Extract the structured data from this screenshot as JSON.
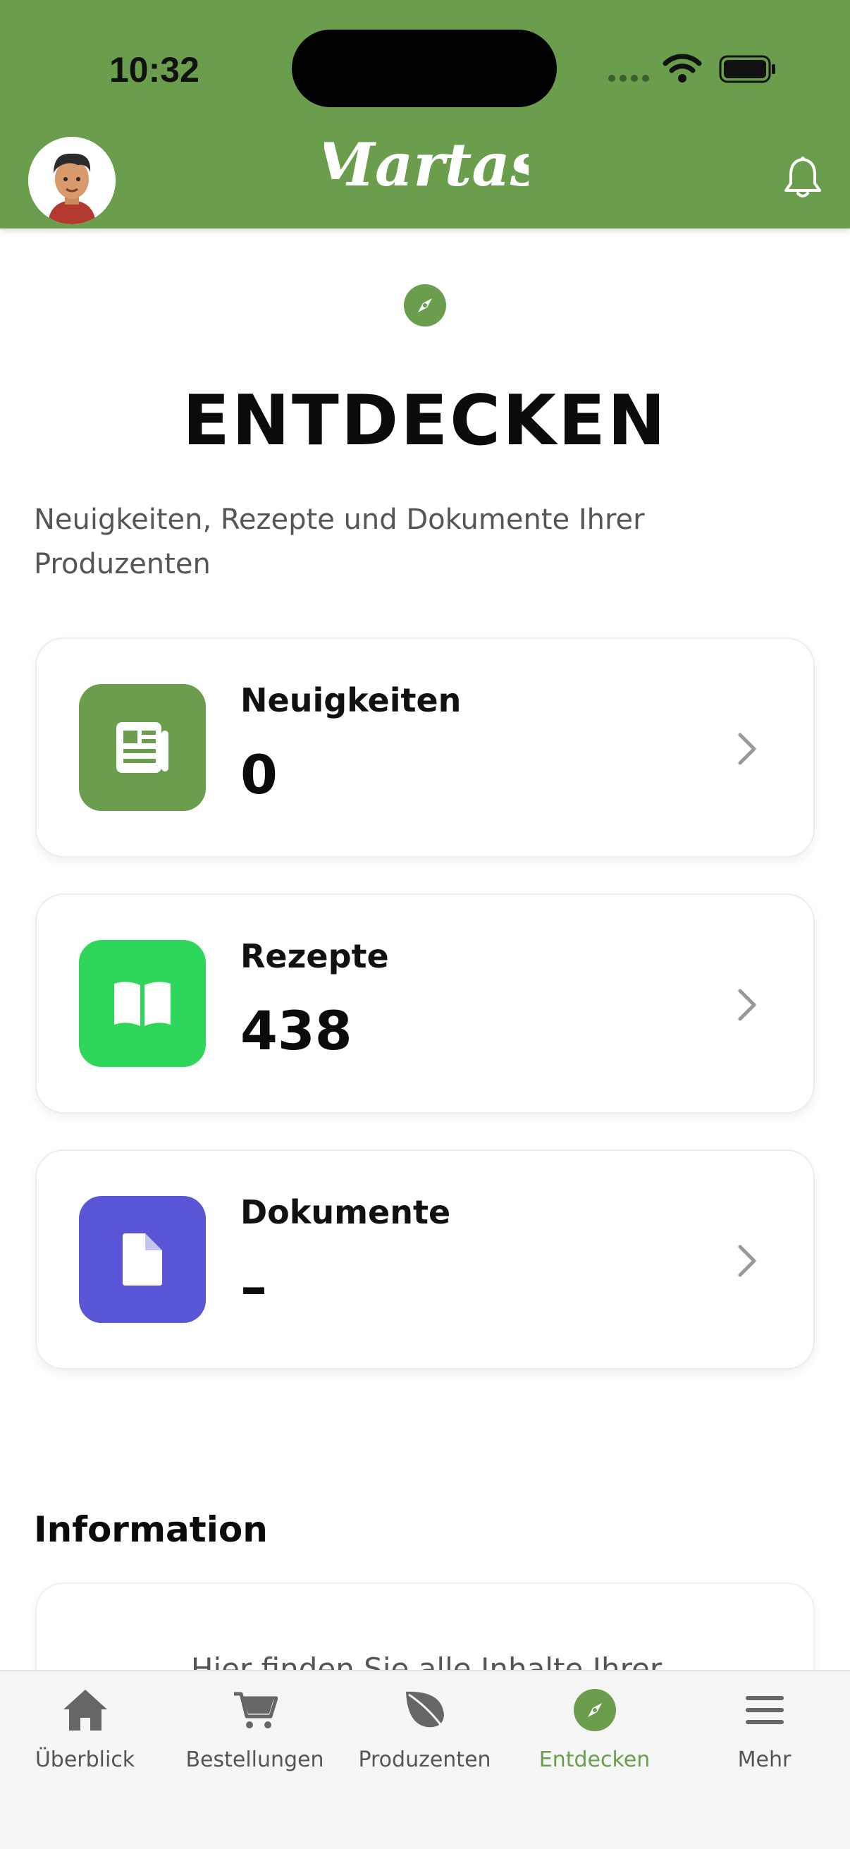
{
  "status_bar": {
    "time": "10:32"
  },
  "header": {
    "logo_text": "Martas",
    "avatar": "avatar",
    "bell_icon": "bell-icon"
  },
  "page": {
    "icon": "compass-icon",
    "title": "ENTDECKEN",
    "subtitle": "Neuigkeiten, Rezepte und Dokumente Ihrer Produzenten"
  },
  "cards": [
    {
      "label": "Neuigkeiten",
      "value": "0",
      "icon": "newspaper-icon",
      "color": "#6a9e4c"
    },
    {
      "label": "Rezepte",
      "value": "438",
      "icon": "book-icon",
      "color": "#2fd65c"
    },
    {
      "label": "Dokumente",
      "value": "–",
      "icon": "document-icon",
      "color": "#5a55d6"
    }
  ],
  "information": {
    "title": "Information",
    "text": "Hier finden Sie alle Inhalte Ihrer"
  },
  "tabbar": {
    "tabs": [
      {
        "label": "Überblick",
        "icon": "home-icon",
        "active": false
      },
      {
        "label": "Bestellungen",
        "icon": "cart-icon",
        "active": false
      },
      {
        "label": "Produzenten",
        "icon": "leaf-icon",
        "active": false
      },
      {
        "label": "Entdecken",
        "icon": "compass-icon",
        "active": true
      },
      {
        "label": "Mehr",
        "icon": "menu-icon",
        "active": false
      }
    ]
  },
  "colors": {
    "brand_green": "#6a9e4c",
    "recipes_green": "#2fd65c",
    "documents_purple": "#5a55d6"
  }
}
